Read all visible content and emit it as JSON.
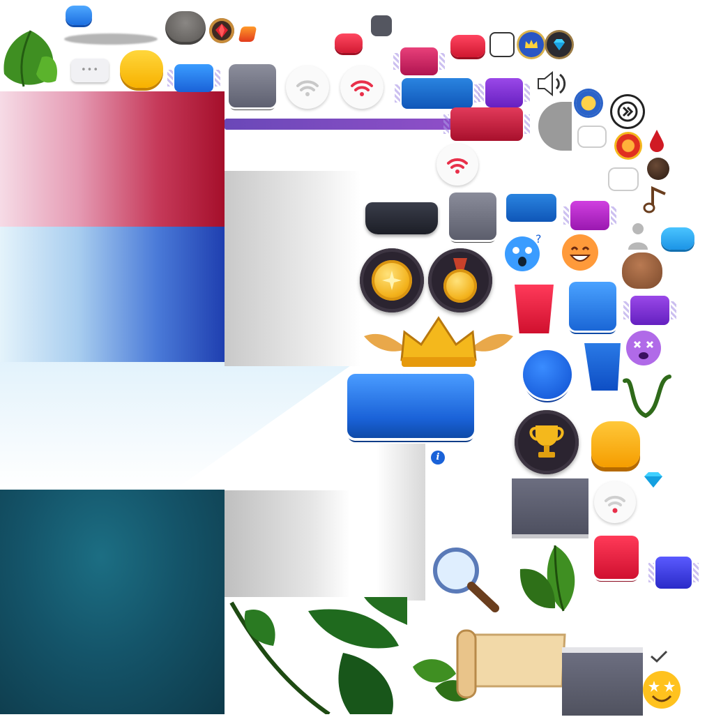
{
  "atlas": {
    "info_glyph": "i",
    "chat_dots": "•••",
    "sprites": [
      "leaf-icon",
      "chat-bubble-icon",
      "wifi-icon",
      "speaker-icon",
      "crown-icon",
      "diamond-icon",
      "ruby-icon",
      "energy-icon",
      "medal-icon",
      "trophy-icon",
      "magnifier-icon",
      "scroll-icon",
      "music-note-icon",
      "user-icon",
      "emoji-icons",
      "vine-icon",
      "checkmark-icon"
    ]
  },
  "colors": {
    "red_panel": "#b0122e",
    "blue_panel": "#2a4fc8",
    "teal_panel": "#15596a",
    "button_blue": "#2a7be6",
    "button_red": "#d9223f",
    "button_purple": "#7e2fd0",
    "button_gray": "#6f7280",
    "gold": "#f4b81c",
    "wifi_red": "#e8304a"
  }
}
